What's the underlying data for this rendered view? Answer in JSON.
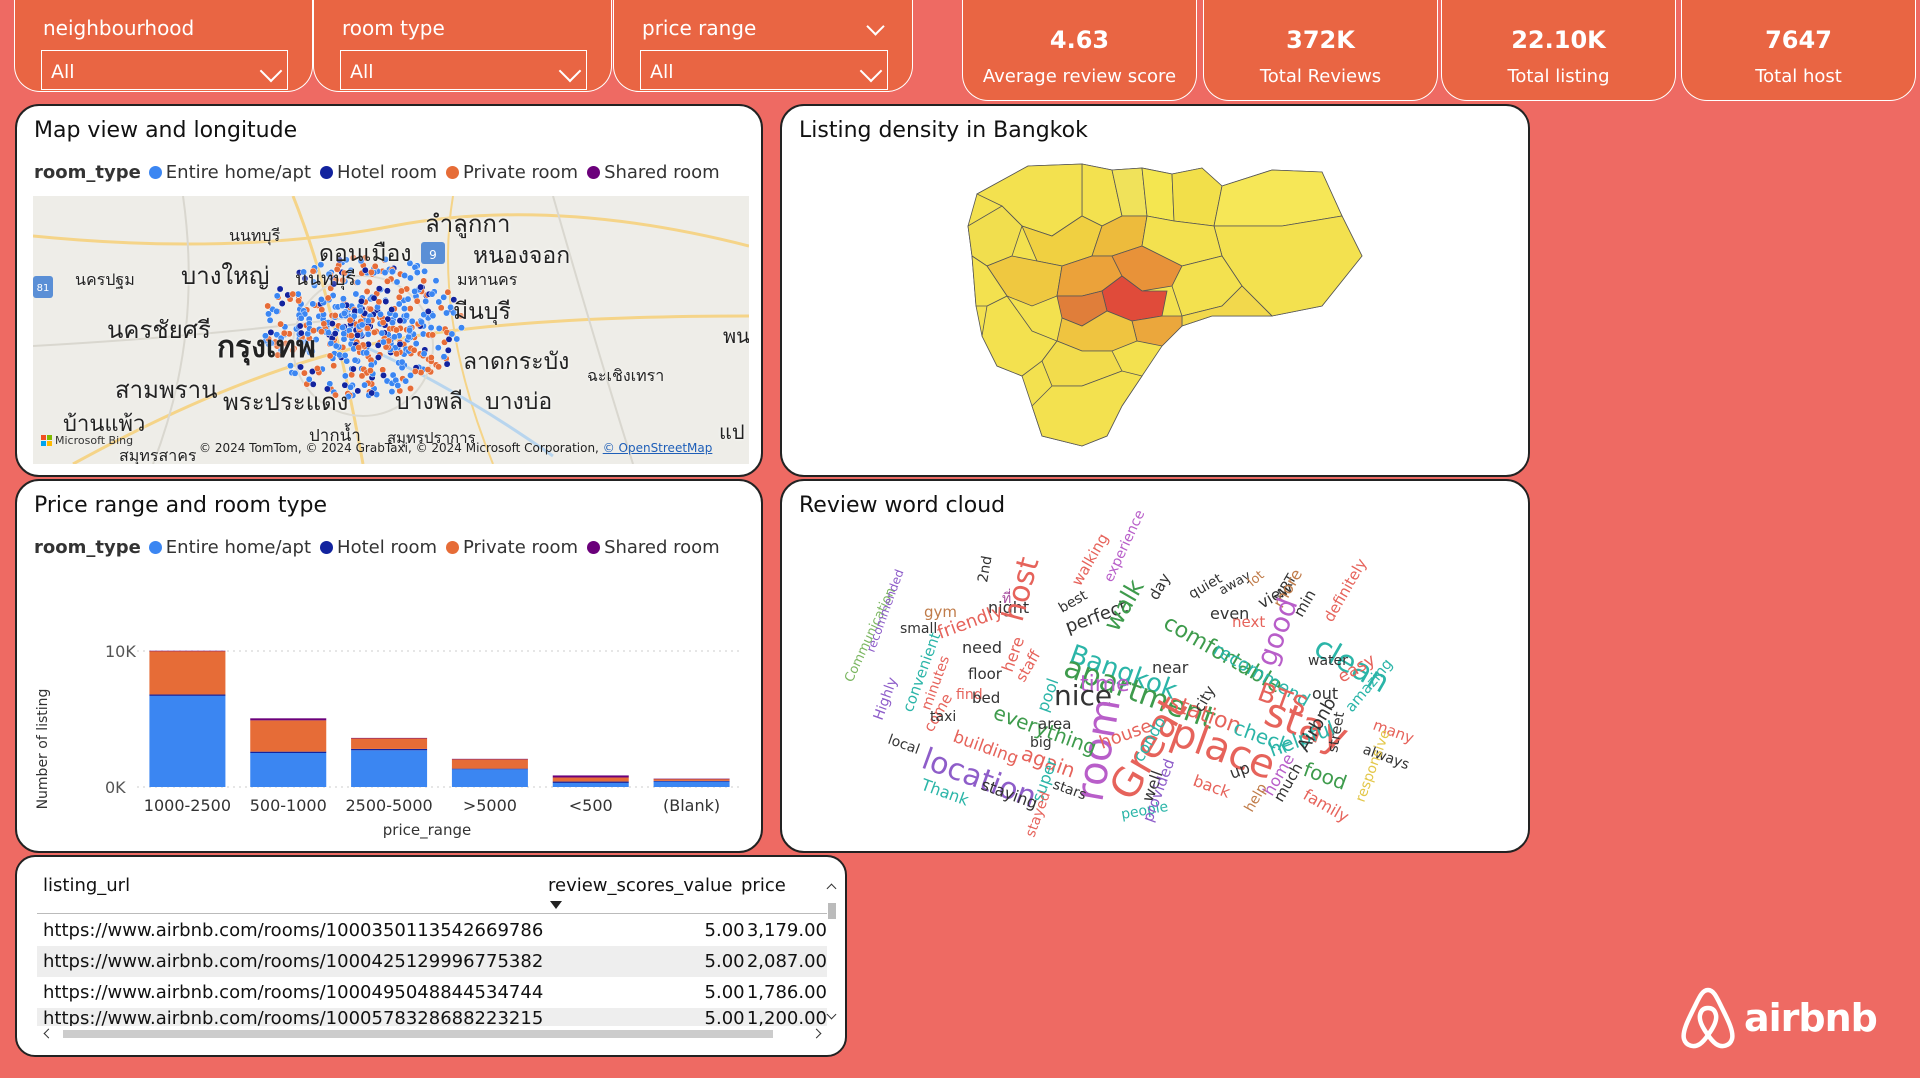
{
  "slicers": [
    {
      "label": "neighbourhood",
      "value": "All"
    },
    {
      "label": "room type",
      "value": "All"
    },
    {
      "label": "price range",
      "value": "All"
    }
  ],
  "kpis": [
    {
      "value": "4.63",
      "caption": "Average review score"
    },
    {
      "value": "372K",
      "caption": "Total Reviews"
    },
    {
      "value": "22.10K",
      "caption": "Total listing"
    },
    {
      "value": "7647",
      "caption": "Total host"
    }
  ],
  "map_panel": {
    "title": "Map view and longitude",
    "legend_title": "room_type",
    "legend": [
      {
        "label": "Entire home/apt",
        "color": "#3B86F2"
      },
      {
        "label": "Hotel room",
        "color": "#12239E"
      },
      {
        "label": "Private room",
        "color": "#E66C37"
      },
      {
        "label": "Shared room",
        "color": "#6B007B"
      }
    ],
    "places": [
      "นนทบุรี",
      "ลำลูกกา",
      "ดอนเมือง",
      "หนองจอก",
      "บางใหญ่",
      "นครปฐม",
      "นนทบุรี",
      "มีนบุรี",
      "มหานคร",
      "นครชัยศรี",
      "กรุงเทพ",
      "ลาดกระบัง",
      "สามพราน",
      "พระประแดง",
      "บางพลี",
      "บางบ่อ",
      "ฉะเชิงเทรา",
      "บ้านแพ้ว",
      "ปากน้ำ",
      "สมุทรปราการ",
      "สมุทรสาคร",
      "พน",
      "แป"
    ],
    "badges": [
      "9",
      "81"
    ],
    "bing": "Microsoft Bing",
    "copyright": "© 2024 TomTom, © 2024 GrabTaxi, © 2024 Microsoft Corporation,",
    "osm": "© OpenStreetMap"
  },
  "density_panel": {
    "title": "Listing density in Bangkok"
  },
  "chart_panel": {
    "title": "Price range and room type",
    "legend_title": "room_type",
    "legend": [
      {
        "label": "Entire home/apt",
        "color": "#3B86F2"
      },
      {
        "label": "Hotel room",
        "color": "#12239E"
      },
      {
        "label": "Private room",
        "color": "#E66C37"
      },
      {
        "label": "Shared room",
        "color": "#6B007B"
      }
    ]
  },
  "chart_data": {
    "type": "bar",
    "stacked": true,
    "categories": [
      "1000-2500",
      "500-1000",
      "2500-5000",
      ">5000",
      "<500",
      "(Blank)"
    ],
    "series": [
      {
        "name": "Entire home/apt",
        "color": "#3B86F2",
        "values": [
          6700,
          2500,
          2700,
          1300,
          300,
          400
        ]
      },
      {
        "name": "Hotel room",
        "color": "#12239E",
        "values": [
          100,
          100,
          100,
          50,
          100,
          50
        ]
      },
      {
        "name": "Private room",
        "color": "#E66C37",
        "values": [
          3200,
          2300,
          800,
          700,
          300,
          150
        ]
      },
      {
        "name": "Shared room",
        "color": "#6B007B",
        "values": [
          20,
          150,
          10,
          20,
          150,
          10
        ]
      }
    ],
    "xlabel": "price_range",
    "ylabel": "Number of listing",
    "yticks": [
      "0K",
      "10K"
    ],
    "ylim": [
      0,
      10000
    ],
    "grid": true
  },
  "wordcloud_panel": {
    "title": "Review word cloud",
    "words": [
      {
        "t": "Communication",
        "c": "#7BB661"
      },
      {
        "t": "recommended",
        "c": "#8E5DC9"
      },
      {
        "t": "gym",
        "c": "#C07C4A"
      },
      {
        "t": "2nd",
        "c": "#333"
      },
      {
        "t": "ที่",
        "c": "#A64D9E"
      },
      {
        "t": "night",
        "c": "#333"
      },
      {
        "t": "host",
        "c": "#E6635B"
      },
      {
        "t": "walking",
        "c": "#E6635B"
      },
      {
        "t": "experience",
        "c": "#B85EC9"
      },
      {
        "t": "day",
        "c": "#333"
      },
      {
        "t": "quiet",
        "c": "#333"
      },
      {
        "t": "away",
        "c": "#333"
      },
      {
        "t": "lot",
        "c": "#C07C4A"
      },
      {
        "t": "MRT",
        "c": "#333"
      },
      {
        "t": "definitely",
        "c": "#E6635B"
      },
      {
        "t": "small",
        "c": "#333"
      },
      {
        "t": "friendly",
        "c": "#E6635B"
      },
      {
        "t": "best",
        "c": "#333"
      },
      {
        "t": "perfect",
        "c": "#333"
      },
      {
        "t": "walk",
        "c": "#3E9B4C"
      },
      {
        "t": "comfortable",
        "c": "#3E9B4C"
      },
      {
        "t": "even",
        "c": "#333"
      },
      {
        "t": "next",
        "c": "#E6635B"
      },
      {
        "t": "view",
        "c": "#333"
      },
      {
        "t": "more",
        "c": "#C07C4A"
      },
      {
        "t": "min",
        "c": "#333"
      },
      {
        "t": "clean",
        "c": "#2BB5A8"
      },
      {
        "t": "Highly",
        "c": "#8E5DC9"
      },
      {
        "t": "convenient",
        "c": "#2BB5A8"
      },
      {
        "t": "minutes",
        "c": "#E6635B"
      },
      {
        "t": "need",
        "c": "#333"
      },
      {
        "t": "staff",
        "c": "#E6635B"
      },
      {
        "t": "Bangkok",
        "c": "#2BB5A8"
      },
      {
        "t": "apartment",
        "c": "#3E9B4C"
      },
      {
        "t": "recommend",
        "c": "#2BB5A8"
      },
      {
        "t": "good",
        "c": "#B85EC9"
      },
      {
        "t": "water",
        "c": "#333"
      },
      {
        "t": "easy",
        "c": "#E6635B"
      },
      {
        "t": "amazing",
        "c": "#2BB5A8"
      },
      {
        "t": "come",
        "c": "#E6635B"
      },
      {
        "t": "floor",
        "c": "#333"
      },
      {
        "t": "here",
        "c": "#E6635B"
      },
      {
        "t": "pool",
        "c": "#2BB5A8"
      },
      {
        "t": "time",
        "c": "#B85EC9"
      },
      {
        "t": "near",
        "c": "#333"
      },
      {
        "t": "station",
        "c": "#E6635B"
      },
      {
        "t": "BTS",
        "c": "#E6635B"
      },
      {
        "t": "out",
        "c": "#333"
      },
      {
        "t": "stay",
        "c": "#E6635B"
      },
      {
        "t": "local",
        "c": "#333"
      },
      {
        "t": "find",
        "c": "#E6635B"
      },
      {
        "t": "bed",
        "c": "#333"
      },
      {
        "t": "nice",
        "c": "#333"
      },
      {
        "t": "room",
        "c": "#B85EC9"
      },
      {
        "t": "Great",
        "c": "#E6635B"
      },
      {
        "t": "place",
        "c": "#E6635B"
      },
      {
        "t": "check",
        "c": "#2BB5A8"
      },
      {
        "t": "helpful",
        "c": "#2BB5A8"
      },
      {
        "t": "Airbnb",
        "c": "#333"
      },
      {
        "t": "street",
        "c": "#333"
      },
      {
        "t": "many",
        "c": "#E6635B"
      },
      {
        "t": "taxi",
        "c": "#333"
      },
      {
        "t": "building",
        "c": "#E6635B"
      },
      {
        "t": "everything",
        "c": "#3E9B4C"
      },
      {
        "t": "area",
        "c": "#333"
      },
      {
        "t": "house",
        "c": "#E6635B"
      },
      {
        "t": "condo",
        "c": "#2BB5A8"
      },
      {
        "t": "city",
        "c": "#333"
      },
      {
        "t": "location",
        "c": "#8E5DC9"
      },
      {
        "t": "again",
        "c": "#E6635B"
      },
      {
        "t": "back",
        "c": "#E6635B"
      },
      {
        "t": "up",
        "c": "#333"
      },
      {
        "t": "home",
        "c": "#B85EC9"
      },
      {
        "t": "food",
        "c": "#3E9B4C"
      },
      {
        "t": "always",
        "c": "#333"
      },
      {
        "t": "Thank",
        "c": "#2BB5A8"
      },
      {
        "t": "big",
        "c": "#333"
      },
      {
        "t": "stars",
        "c": "#333"
      },
      {
        "t": "staying",
        "c": "#333"
      },
      {
        "t": "super",
        "c": "#2BB5A8"
      },
      {
        "t": "stayed",
        "c": "#E6635B"
      },
      {
        "t": "people",
        "c": "#2BB5A8"
      },
      {
        "t": "well",
        "c": "#333"
      },
      {
        "t": "provided",
        "c": "#8E5DC9"
      },
      {
        "t": "help",
        "c": "#C07C4A"
      },
      {
        "t": "much",
        "c": "#333"
      },
      {
        "t": "family",
        "c": "#E6635B"
      },
      {
        "t": "responsive",
        "c": "#E3C74A"
      }
    ]
  },
  "table": {
    "columns": [
      "listing_url",
      "review_scores_value",
      "price"
    ],
    "rows": [
      [
        "https://www.airbnb.com/rooms/1000350113542669786",
        "5.00",
        "3,179.00"
      ],
      [
        "https://www.airbnb.com/rooms/1000425129996775382",
        "5.00",
        "2,087.00"
      ],
      [
        "https://www.airbnb.com/rooms/1000495048844534744",
        "5.00",
        "1,786.00"
      ],
      [
        "https://www.airbnb.com/rooms/1000578328688223215",
        "5.00",
        "1,200.00"
      ]
    ]
  },
  "brand": {
    "name": "airbnb"
  }
}
